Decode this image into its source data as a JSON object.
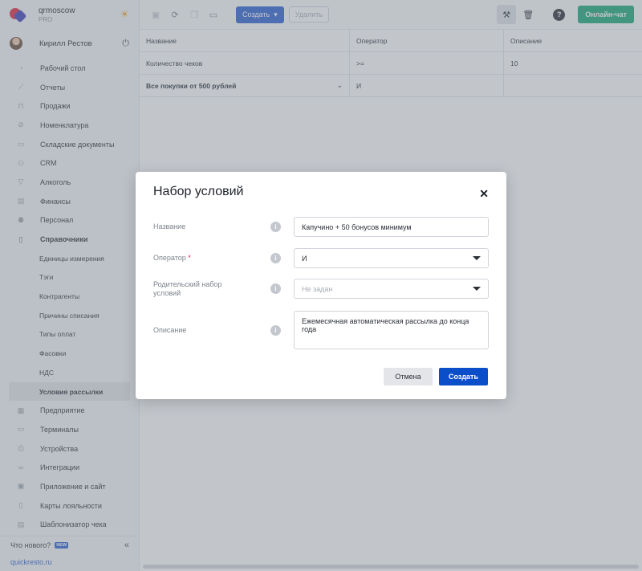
{
  "sidebar": {
    "org_name": "qrmoscow",
    "org_plan": "PRO",
    "user_name": "Кирилл Рестов",
    "items": [
      {
        "label": "Рабочий стол",
        "icon": "dashboard-icon"
      },
      {
        "label": "Отчеты",
        "icon": "chart-icon"
      },
      {
        "label": "Продажи",
        "icon": "basket-icon"
      },
      {
        "label": "Номенклатура",
        "icon": "tag-icon"
      },
      {
        "label": "Складские документы",
        "icon": "archive-icon"
      },
      {
        "label": "CRM",
        "icon": "users-icon"
      },
      {
        "label": "Алкоголь",
        "icon": "glass-icon"
      },
      {
        "label": "Финансы",
        "icon": "wallet-icon"
      },
      {
        "label": "Персонал",
        "icon": "staff-icon"
      },
      {
        "label": "Справочники",
        "icon": "book-icon"
      }
    ],
    "sub_items": [
      {
        "label": "Единицы измерения"
      },
      {
        "label": "Тэги"
      },
      {
        "label": "Контрагенты"
      },
      {
        "label": "Причины списания"
      },
      {
        "label": "Типы оплат"
      },
      {
        "label": "Фасовки"
      },
      {
        "label": "НДС"
      },
      {
        "label": "Условия рассылки"
      }
    ],
    "items_after": [
      {
        "label": "Предприятие",
        "icon": "building-icon"
      },
      {
        "label": "Терминалы",
        "icon": "terminal-icon"
      },
      {
        "label": "Устройства",
        "icon": "printer-icon"
      },
      {
        "label": "Интеграции",
        "icon": "link-icon"
      },
      {
        "label": "Приложение и сайт",
        "icon": "app-icon"
      },
      {
        "label": "Карты лояльности",
        "icon": "card-icon"
      },
      {
        "label": "Шаблонизатор чека",
        "icon": "receipt-icon"
      }
    ],
    "whats_new": "Что нового?",
    "new_badge": "NEW",
    "site_link": "quickresto.ru"
  },
  "toolbar": {
    "create_label": "Создать",
    "delete_label": "Удалить",
    "chat_label": "Онлайн-чат"
  },
  "table": {
    "headers": [
      "Название",
      "Оператор",
      "Описание"
    ],
    "rows": [
      [
        "Количество чеков",
        ">=",
        "10"
      ],
      [
        "Все покупки от 500 рублей",
        "И",
        ""
      ]
    ]
  },
  "modal": {
    "title": "Набор условий",
    "fields": {
      "name_label": "Название",
      "name_value": "Капучино + 50 бонусов минимум",
      "operator_label": "Оператор",
      "operator_required": "*",
      "operator_value": "И",
      "parent_label": "Родительский набор условий",
      "parent_placeholder": "Не задан",
      "description_label": "Описание",
      "description_value": "Ежемесячная автоматическая рассылка до конца года"
    },
    "cancel_label": "Отмена",
    "submit_label": "Создать"
  }
}
